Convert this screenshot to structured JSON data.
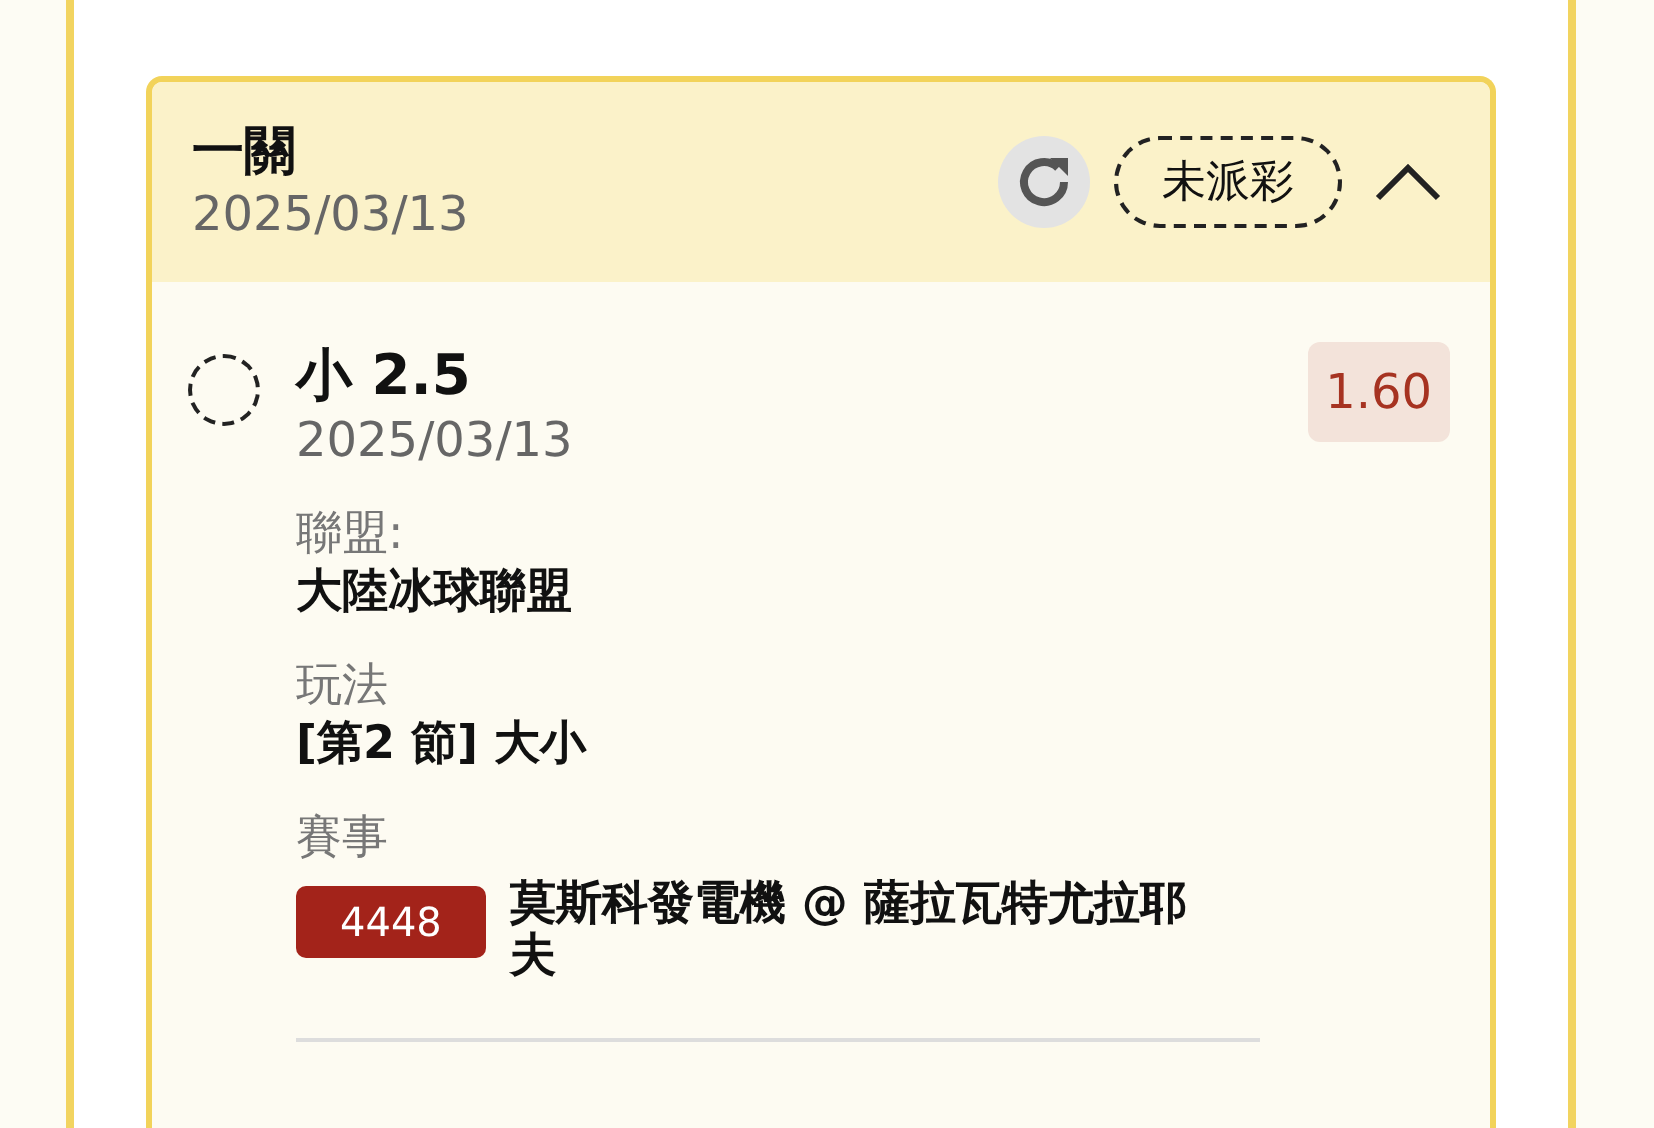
{
  "bet": {
    "title": "一關",
    "date": "2025/03/13",
    "status": "未派彩",
    "expanded": true,
    "selection": {
      "name": "小 2.5",
      "date": "2025/03/13",
      "odds": "1.60",
      "settled": false,
      "fields": [
        {
          "label": "聯盟:",
          "value": "大陸冰球聯盟"
        },
        {
          "label": "玩法",
          "value": "[第2 節] 大小"
        }
      ],
      "match": {
        "label": "賽事",
        "code": "4448",
        "name": "莫斯科發電機 @ 薩拉瓦特尤拉耶夫"
      }
    }
  }
}
